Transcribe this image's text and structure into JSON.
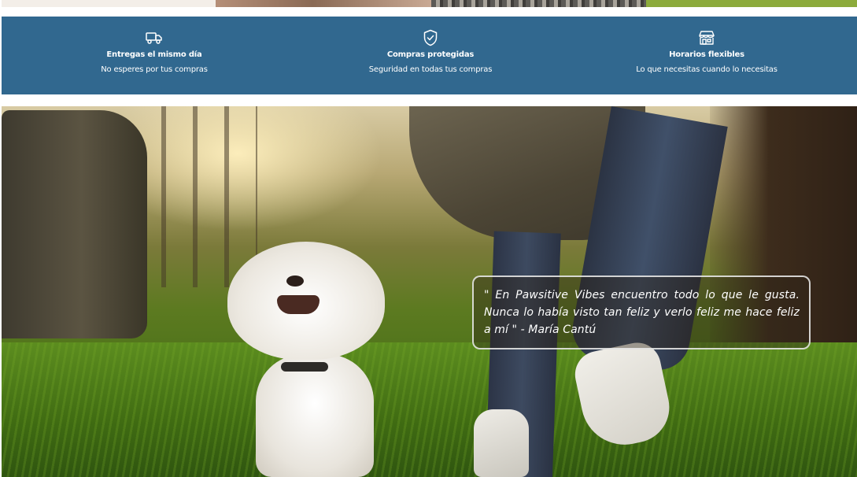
{
  "top_strip": {
    "colors": [
      "#f3eee8",
      "#a47f69",
      "#6e6a63",
      "#8cab3c"
    ]
  },
  "features": [
    {
      "icon": "truck-icon",
      "title": "Entregas el mismo día",
      "subtitle": "No esperes por tus compras"
    },
    {
      "icon": "shield-check-icon",
      "title": "Compras protegidas",
      "subtitle": "Seguridad en todas tus compras"
    },
    {
      "icon": "store-icon",
      "title": "Horarios flexibles",
      "subtitle": "Lo que necesitas cuando lo necesitas"
    }
  ],
  "colors": {
    "feature_bar_bg": "#31688f",
    "text_light": "#ffffff"
  },
  "testimonial": {
    "text": "\" En Pawsitive Vibes encuentro todo lo que le gusta. Nunca lo había visto tan feliz y verlo feliz me hace feliz a mí \" - María Cantú"
  }
}
